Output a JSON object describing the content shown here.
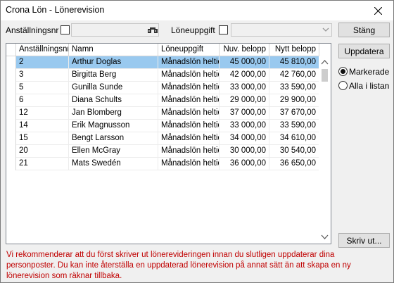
{
  "window": {
    "title": "Crona Lön - Lönerevision"
  },
  "filters": {
    "employee_no_label": "Anställningsnr",
    "employee_no_checked": false,
    "employee_no_value": "",
    "wage_type_label": "Löneuppgift",
    "wage_type_checked": false,
    "wage_type_value": ""
  },
  "buttons": {
    "close": "Stäng",
    "update": "Uppdatera",
    "print": "Skriv ut..."
  },
  "scope": {
    "options": [
      "Markerade",
      "Alla i listan"
    ],
    "selected": "Markerade"
  },
  "table": {
    "columns": [
      "Anställningsnr",
      "Namn",
      "Löneuppgift",
      "Nuv. belopp",
      "Nytt belopp"
    ],
    "rows": [
      {
        "emp": "2",
        "name": "Arthur Doglas",
        "wage": "Månadslön heltid",
        "current": "45 000,00",
        "new": "45 810,00",
        "selected": true
      },
      {
        "emp": "3",
        "name": "Birgitta Berg",
        "wage": "Månadslön heltid",
        "current": "42 000,00",
        "new": "42 760,00",
        "selected": false
      },
      {
        "emp": "5",
        "name": "Gunilla Sunde",
        "wage": "Månadslön heltid",
        "current": "33 000,00",
        "new": "33 590,00",
        "selected": false
      },
      {
        "emp": "6",
        "name": "Diana Schults",
        "wage": "Månadslön heltid",
        "current": "29 000,00",
        "new": "29 900,00",
        "selected": false
      },
      {
        "emp": "12",
        "name": "Jan Blomberg",
        "wage": "Månadslön heltid",
        "current": "37 000,00",
        "new": "37 670,00",
        "selected": false
      },
      {
        "emp": "14",
        "name": "Erik Magnusson",
        "wage": "Månadslön heltid",
        "current": "33 000,00",
        "new": "33 590,00",
        "selected": false
      },
      {
        "emp": "15",
        "name": "Bengt Larsson",
        "wage": "Månadslön heltid",
        "current": "34 000,00",
        "new": "34 610,00",
        "selected": false
      },
      {
        "emp": "20",
        "name": "Ellen McGray",
        "wage": "Månadslön heltid",
        "current": "30 000,00",
        "new": "30 540,00",
        "selected": false
      },
      {
        "emp": "21",
        "name": "Mats Swedén",
        "wage": "Månadslön heltid",
        "current": "36 000,00",
        "new": "36 650,00",
        "selected": false
      }
    ]
  },
  "warning": "Vi rekommenderar att du först skriver ut lönerevideringen innan du slutligen uppdaterar dina personposter. Du kan inte återställa en uppdaterad lönerevision på annat sätt än att skapa en ny lönerevision som räknar tillbaka.",
  "colors": {
    "selection": "#99c9ef",
    "warning_text": "#c00000",
    "window_bg": "#f0f0f0"
  }
}
